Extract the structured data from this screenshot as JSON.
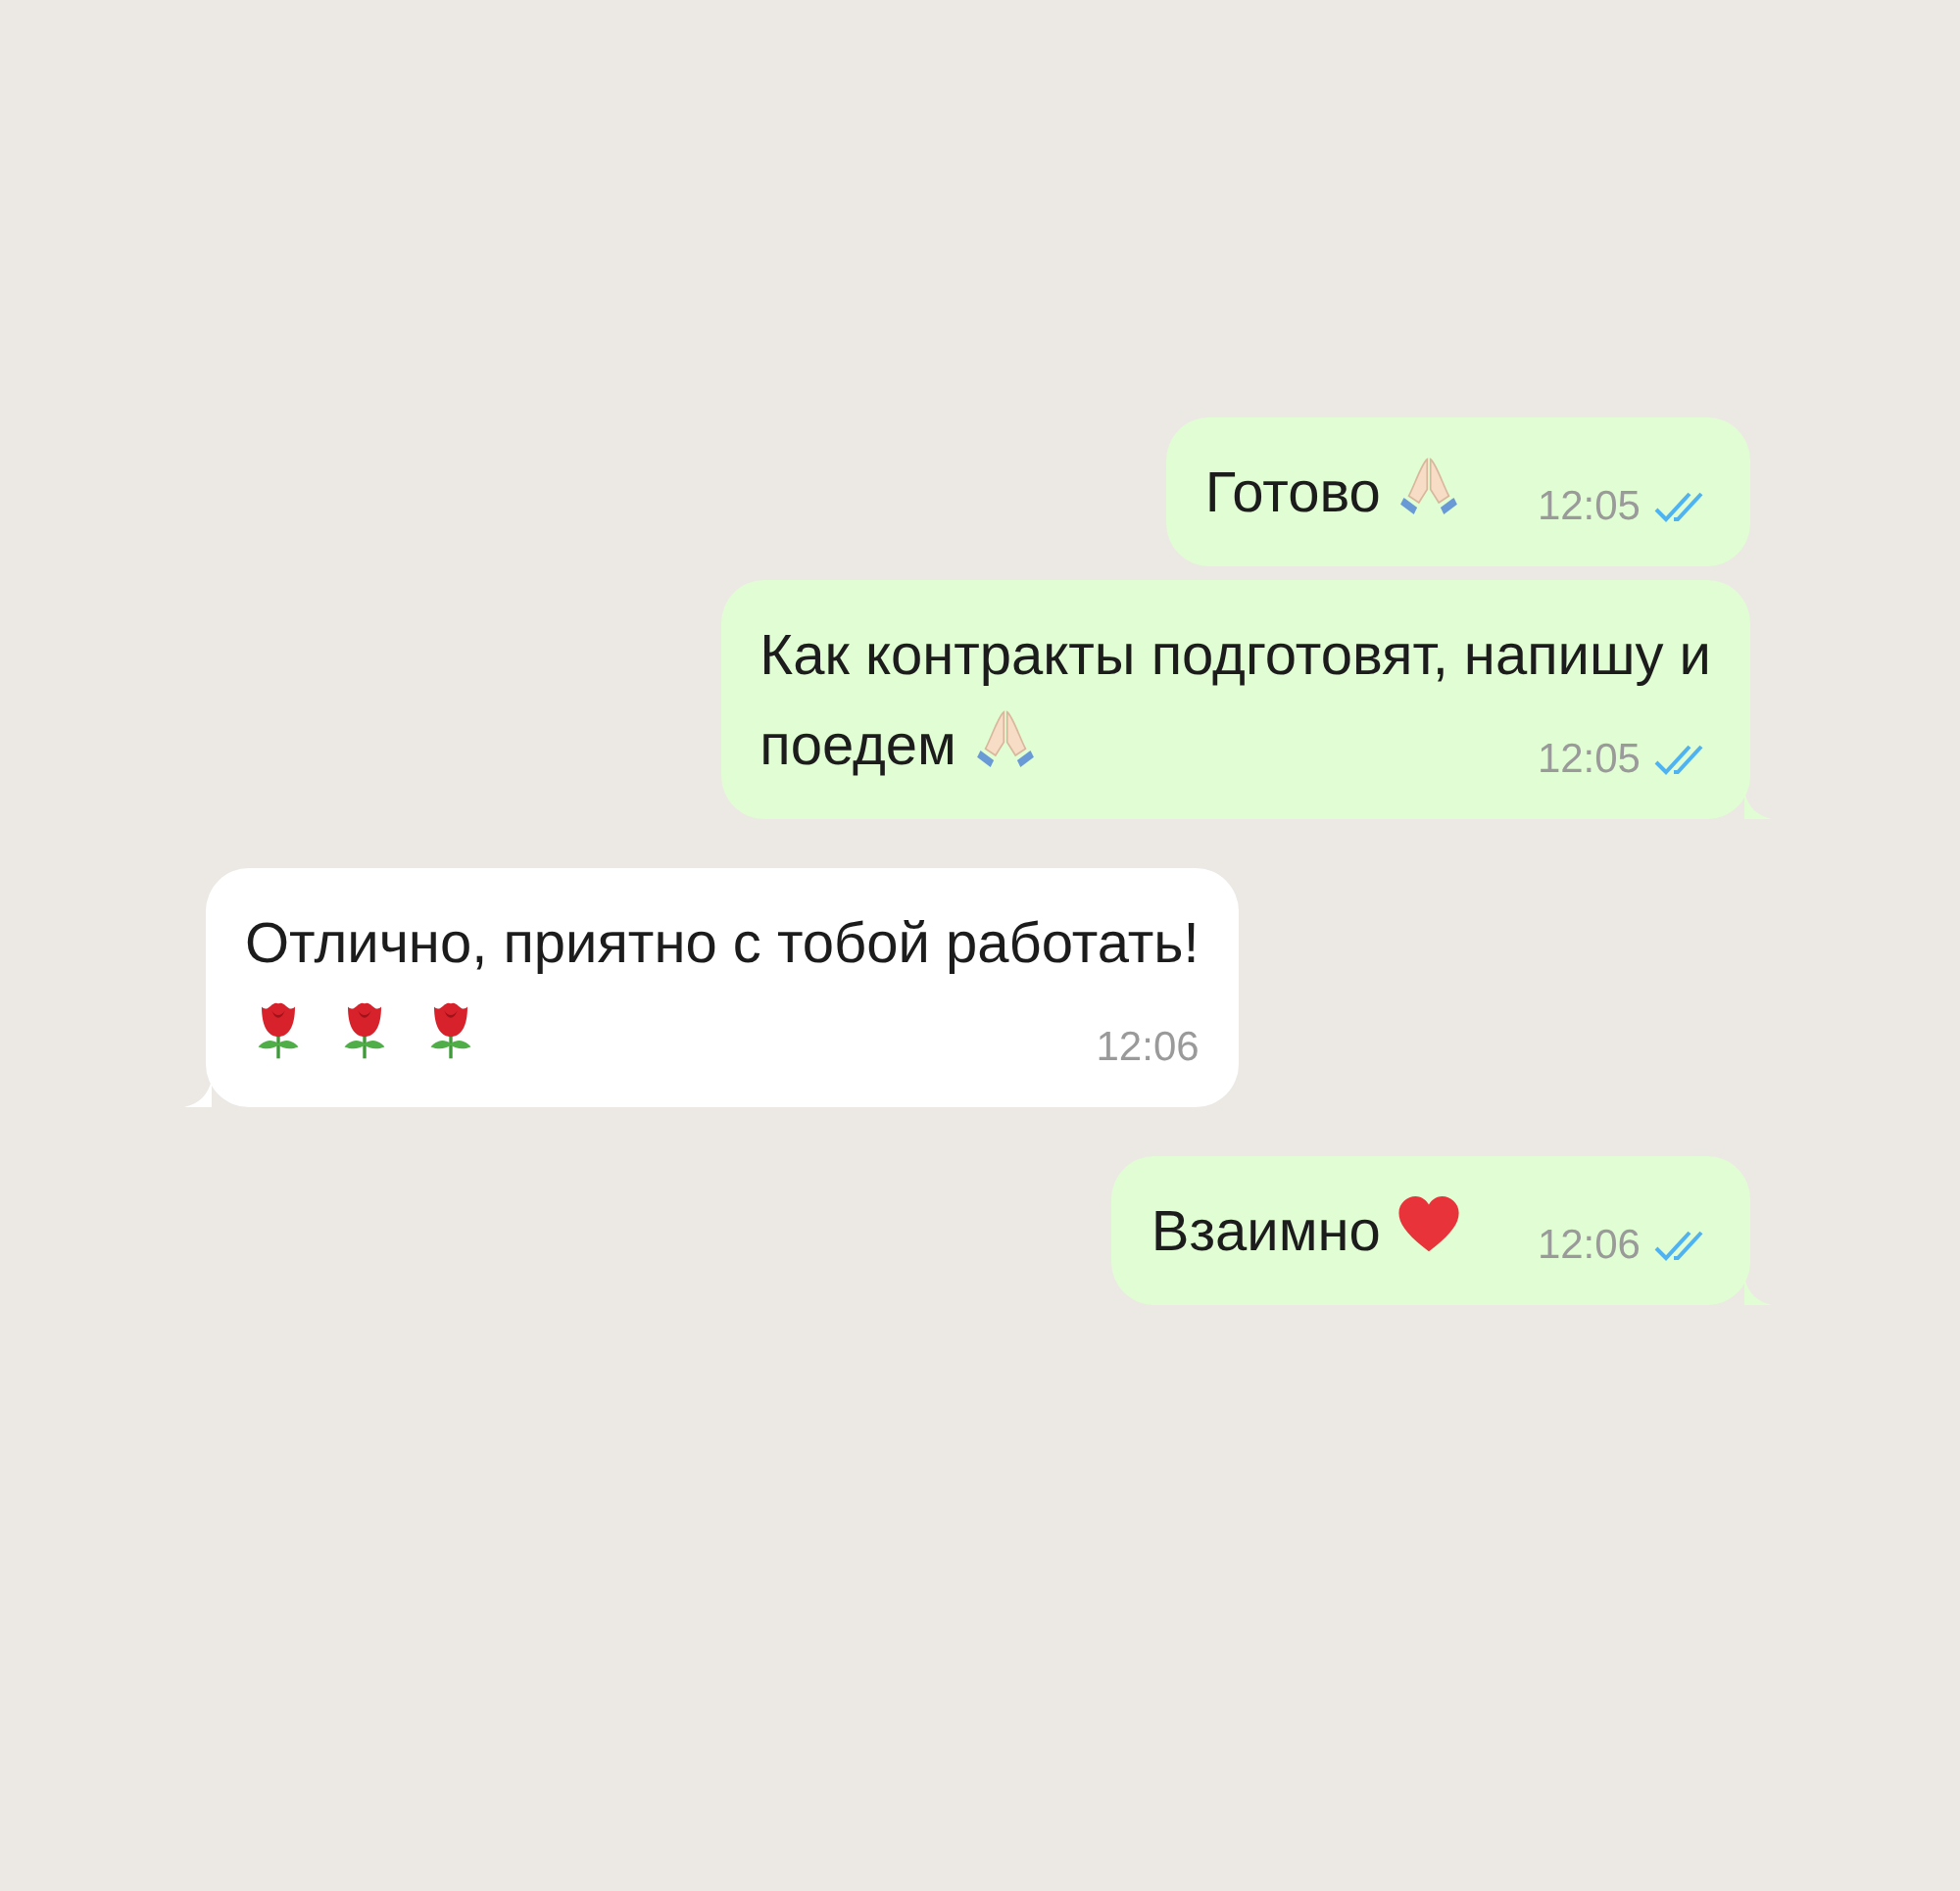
{
  "messages": [
    {
      "kind": "out",
      "lines": [
        {
          "text": "Готово",
          "emojis": [
            {
              "kind": "pray"
            }
          ]
        }
      ],
      "time": "12:05",
      "read": true,
      "tail": false
    },
    {
      "kind": "out",
      "lines": [
        {
          "text": "Как контракты подготовят, напишу и"
        },
        {
          "text": "поедем",
          "emojis": [
            {
              "kind": "pray"
            }
          ]
        }
      ],
      "time": "12:05",
      "read": true,
      "tail": true
    },
    {
      "kind": "in",
      "lines": [
        {
          "text": "Отлично, приятно с тобой работать!"
        },
        {
          "emojis": [
            {
              "kind": "rose"
            },
            {
              "kind": "rose"
            },
            {
              "kind": "rose"
            }
          ]
        }
      ],
      "time": "12:06",
      "tail": true
    },
    {
      "kind": "out",
      "lines": [
        {
          "text": "Взаимно",
          "emojis": [
            {
              "kind": "heart"
            }
          ]
        }
      ],
      "time": "12:06",
      "read": true,
      "tail": true
    }
  ]
}
